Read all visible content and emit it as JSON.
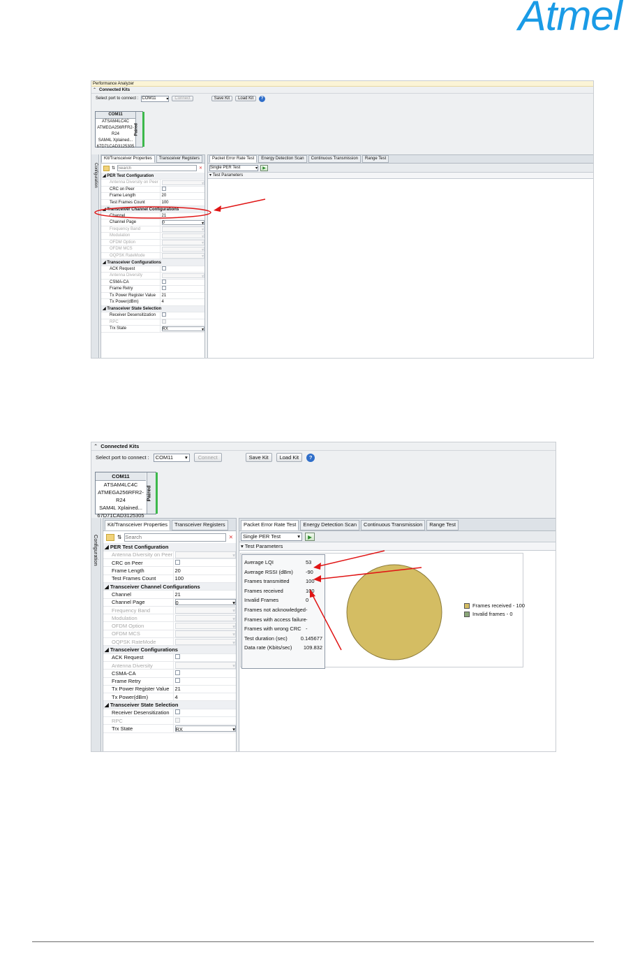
{
  "brand": {
    "logo_text": "Atmel",
    "color": "#1a9be6"
  },
  "shot1": {
    "window_title": "Performance Analyzer",
    "connected_kits": "Connected Kits",
    "select_port_label": "Select port to connect :",
    "port_value": "COM11",
    "connect_label": "Connect",
    "save_kit_label": "Save Kit",
    "load_kit_label": "Load Kit",
    "kit": {
      "title": "COM11",
      "lines": [
        "ATSAM4LC4C",
        "ATMEGA256RFR2-R24",
        "SAM4L Xplained...",
        "67D71CAD3125305"
      ],
      "status": "Paired"
    },
    "sidebar_label": "Configuration",
    "left_tabs": [
      "Kit/Transceiver Properties",
      "Transceiver Registers"
    ],
    "search_placeholder": "Search",
    "props": [
      {
        "type": "cat",
        "name": "PER Test Configuration"
      },
      {
        "name": "Antenna Diversity on Peer",
        "kind": "dd",
        "disabled": true,
        "value": ""
      },
      {
        "name": "CRC on Peer",
        "kind": "chk"
      },
      {
        "name": "Frame Length",
        "kind": "text",
        "value": "20"
      },
      {
        "name": "Test Frames Count",
        "kind": "text",
        "value": "100"
      },
      {
        "type": "cat",
        "name": "Transceiver Channel Configurations"
      },
      {
        "name": "Channel",
        "kind": "text",
        "value": "21"
      },
      {
        "name": "Channel Page",
        "kind": "dd",
        "value": "0"
      },
      {
        "name": "Frequency Band",
        "kind": "dd",
        "disabled": true,
        "value": ""
      },
      {
        "name": "Modulation",
        "kind": "dd",
        "disabled": true,
        "value": ""
      },
      {
        "name": "OFDM Option",
        "kind": "dd",
        "disabled": true,
        "value": ""
      },
      {
        "name": "OFDM MCS",
        "kind": "dd",
        "disabled": true,
        "value": ""
      },
      {
        "name": "OQPSK RateMode",
        "kind": "dd",
        "disabled": true,
        "value": ""
      },
      {
        "type": "cat",
        "name": "Transceiver Configurations"
      },
      {
        "name": "ACK Request",
        "kind": "chk"
      },
      {
        "name": "Antenna Diversity",
        "kind": "dd",
        "disabled": true,
        "value": ""
      },
      {
        "name": "CSMA-CA",
        "kind": "chk"
      },
      {
        "name": "Frame Retry",
        "kind": "chk"
      },
      {
        "name": "Tx Power Register Value",
        "kind": "text",
        "value": "21"
      },
      {
        "name": "Tx Power(dBm)",
        "kind": "text",
        "value": "4"
      },
      {
        "type": "cat",
        "name": "Transceiver State Selection"
      },
      {
        "name": "Receiver Desensitization",
        "kind": "chk"
      },
      {
        "name": "RPC",
        "kind": "chk",
        "disabled": true
      },
      {
        "name": "Trx State",
        "kind": "dd",
        "value": "RX"
      }
    ],
    "right_tabs": [
      "Packet Error Rate Test",
      "Energy Detection Scan",
      "Continuous Transmission",
      "Range Test"
    ],
    "test_mode": "Single PER Test",
    "test_params": "Test Parameters"
  },
  "shot2": {
    "connected_kits": "Connected Kits",
    "select_port_label": "Select port to connect :",
    "port_value": "COM11",
    "connect_label": "Connect",
    "save_kit_label": "Save Kit",
    "load_kit_label": "Load Kit",
    "kit": {
      "title": "COM11",
      "lines": [
        "ATSAM4LC4C",
        "ATMEGA256RFR2-R24",
        "SAM4L Xplained...",
        "67D71CAD3125305"
      ],
      "status": "Paired"
    },
    "sidebar_label": "Configuration",
    "left_tabs": [
      "Kit/Transceiver Properties",
      "Transceiver Registers"
    ],
    "search_placeholder": "Search",
    "props": [
      {
        "type": "cat",
        "name": "PER Test Configuration"
      },
      {
        "name": "Antenna Diversity on Peer",
        "kind": "dd",
        "disabled": true,
        "value": ""
      },
      {
        "name": "CRC on Peer",
        "kind": "chk"
      },
      {
        "name": "Frame Length",
        "kind": "text",
        "value": "20"
      },
      {
        "name": "Test Frames Count",
        "kind": "text",
        "value": "100"
      },
      {
        "type": "cat",
        "name": "Transceiver Channel Configurations"
      },
      {
        "name": "Channel",
        "kind": "text",
        "value": "21"
      },
      {
        "name": "Channel Page",
        "kind": "dd",
        "value": "0"
      },
      {
        "name": "Frequency Band",
        "kind": "dd",
        "disabled": true,
        "value": ""
      },
      {
        "name": "Modulation",
        "kind": "dd",
        "disabled": true,
        "value": ""
      },
      {
        "name": "OFDM Option",
        "kind": "dd",
        "disabled": true,
        "value": ""
      },
      {
        "name": "OFDM MCS",
        "kind": "dd",
        "disabled": true,
        "value": ""
      },
      {
        "name": "OQPSK RateMode",
        "kind": "dd",
        "disabled": true,
        "value": ""
      },
      {
        "type": "cat",
        "name": "Transceiver Configurations"
      },
      {
        "name": "ACK Request",
        "kind": "chk"
      },
      {
        "name": "Antenna Diversity",
        "kind": "dd",
        "disabled": true,
        "value": ""
      },
      {
        "name": "CSMA-CA",
        "kind": "chk"
      },
      {
        "name": "Frame Retry",
        "kind": "chk"
      },
      {
        "name": "Tx Power Register Value",
        "kind": "text",
        "value": "21"
      },
      {
        "name": "Tx Power(dBm)",
        "kind": "text",
        "value": "4"
      },
      {
        "type": "cat",
        "name": "Transceiver State Selection"
      },
      {
        "name": "Receiver Desensitization",
        "kind": "chk"
      },
      {
        "name": "RPC",
        "kind": "chk",
        "disabled": true
      },
      {
        "name": "Trx State",
        "kind": "dd",
        "value": "RX"
      }
    ],
    "right_tabs": [
      "Packet Error Rate Test",
      "Energy Detection Scan",
      "Continuous Transmission",
      "Range Test"
    ],
    "test_mode": "Single PER Test",
    "test_params": "Test Parameters",
    "results": [
      {
        "label": "Average LQI",
        "value": "53"
      },
      {
        "label": "Average RSSI (dBm)",
        "value": "-90"
      },
      {
        "label": "Frames transmitted",
        "value": "100"
      },
      {
        "label": "Frames received",
        "value": "100"
      },
      {
        "label": "Invalid Frames",
        "value": "0"
      },
      {
        "label": "Frames not acknowledged",
        "value": "-"
      },
      {
        "label": "Frames with access failure",
        "value": "-"
      },
      {
        "label": "Frames with wrong CRC",
        "value": "-"
      },
      {
        "label": "Test duration (sec)",
        "value": "0.145677"
      },
      {
        "label": "Data rate (Kbits/sec)",
        "value": "109.832"
      }
    ],
    "legend": [
      {
        "label": "Frames received - 100",
        "color": "#d4bd63"
      },
      {
        "label": "Invalid frames - 0",
        "color": "#8aa678"
      }
    ]
  },
  "chart_data": {
    "type": "pie",
    "categories": [
      "Frames received",
      "Invalid frames"
    ],
    "values": [
      100,
      0
    ],
    "colors": [
      "#d4bd63",
      "#8aa678"
    ]
  },
  "annotation_color": "#e01515"
}
